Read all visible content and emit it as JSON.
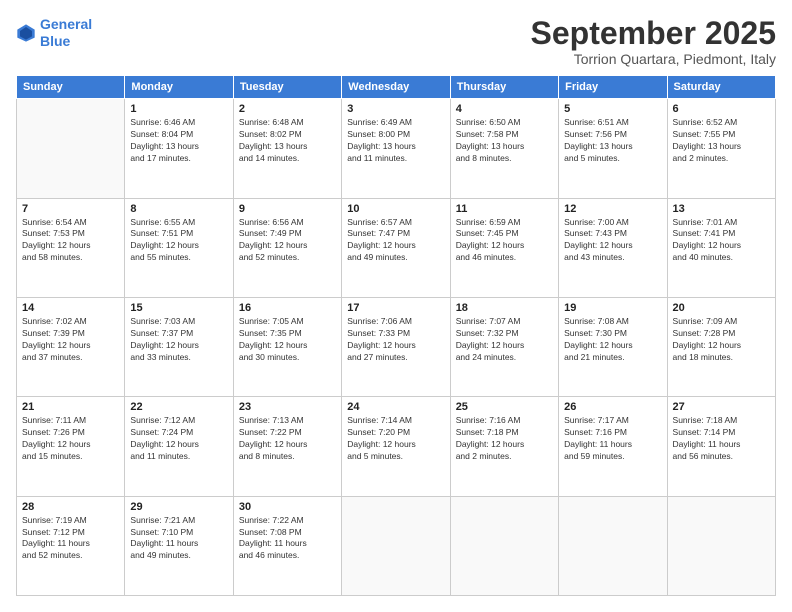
{
  "header": {
    "logo_line1": "General",
    "logo_line2": "Blue",
    "month_title": "September 2025",
    "location": "Torrion Quartara, Piedmont, Italy"
  },
  "weekdays": [
    "Sunday",
    "Monday",
    "Tuesday",
    "Wednesday",
    "Thursday",
    "Friday",
    "Saturday"
  ],
  "weeks": [
    [
      {
        "day": "",
        "info": ""
      },
      {
        "day": "1",
        "info": "Sunrise: 6:46 AM\nSunset: 8:04 PM\nDaylight: 13 hours\nand 17 minutes."
      },
      {
        "day": "2",
        "info": "Sunrise: 6:48 AM\nSunset: 8:02 PM\nDaylight: 13 hours\nand 14 minutes."
      },
      {
        "day": "3",
        "info": "Sunrise: 6:49 AM\nSunset: 8:00 PM\nDaylight: 13 hours\nand 11 minutes."
      },
      {
        "day": "4",
        "info": "Sunrise: 6:50 AM\nSunset: 7:58 PM\nDaylight: 13 hours\nand 8 minutes."
      },
      {
        "day": "5",
        "info": "Sunrise: 6:51 AM\nSunset: 7:56 PM\nDaylight: 13 hours\nand 5 minutes."
      },
      {
        "day": "6",
        "info": "Sunrise: 6:52 AM\nSunset: 7:55 PM\nDaylight: 13 hours\nand 2 minutes."
      }
    ],
    [
      {
        "day": "7",
        "info": "Sunrise: 6:54 AM\nSunset: 7:53 PM\nDaylight: 12 hours\nand 58 minutes."
      },
      {
        "day": "8",
        "info": "Sunrise: 6:55 AM\nSunset: 7:51 PM\nDaylight: 12 hours\nand 55 minutes."
      },
      {
        "day": "9",
        "info": "Sunrise: 6:56 AM\nSunset: 7:49 PM\nDaylight: 12 hours\nand 52 minutes."
      },
      {
        "day": "10",
        "info": "Sunrise: 6:57 AM\nSunset: 7:47 PM\nDaylight: 12 hours\nand 49 minutes."
      },
      {
        "day": "11",
        "info": "Sunrise: 6:59 AM\nSunset: 7:45 PM\nDaylight: 12 hours\nand 46 minutes."
      },
      {
        "day": "12",
        "info": "Sunrise: 7:00 AM\nSunset: 7:43 PM\nDaylight: 12 hours\nand 43 minutes."
      },
      {
        "day": "13",
        "info": "Sunrise: 7:01 AM\nSunset: 7:41 PM\nDaylight: 12 hours\nand 40 minutes."
      }
    ],
    [
      {
        "day": "14",
        "info": "Sunrise: 7:02 AM\nSunset: 7:39 PM\nDaylight: 12 hours\nand 37 minutes."
      },
      {
        "day": "15",
        "info": "Sunrise: 7:03 AM\nSunset: 7:37 PM\nDaylight: 12 hours\nand 33 minutes."
      },
      {
        "day": "16",
        "info": "Sunrise: 7:05 AM\nSunset: 7:35 PM\nDaylight: 12 hours\nand 30 minutes."
      },
      {
        "day": "17",
        "info": "Sunrise: 7:06 AM\nSunset: 7:33 PM\nDaylight: 12 hours\nand 27 minutes."
      },
      {
        "day": "18",
        "info": "Sunrise: 7:07 AM\nSunset: 7:32 PM\nDaylight: 12 hours\nand 24 minutes."
      },
      {
        "day": "19",
        "info": "Sunrise: 7:08 AM\nSunset: 7:30 PM\nDaylight: 12 hours\nand 21 minutes."
      },
      {
        "day": "20",
        "info": "Sunrise: 7:09 AM\nSunset: 7:28 PM\nDaylight: 12 hours\nand 18 minutes."
      }
    ],
    [
      {
        "day": "21",
        "info": "Sunrise: 7:11 AM\nSunset: 7:26 PM\nDaylight: 12 hours\nand 15 minutes."
      },
      {
        "day": "22",
        "info": "Sunrise: 7:12 AM\nSunset: 7:24 PM\nDaylight: 12 hours\nand 11 minutes."
      },
      {
        "day": "23",
        "info": "Sunrise: 7:13 AM\nSunset: 7:22 PM\nDaylight: 12 hours\nand 8 minutes."
      },
      {
        "day": "24",
        "info": "Sunrise: 7:14 AM\nSunset: 7:20 PM\nDaylight: 12 hours\nand 5 minutes."
      },
      {
        "day": "25",
        "info": "Sunrise: 7:16 AM\nSunset: 7:18 PM\nDaylight: 12 hours\nand 2 minutes."
      },
      {
        "day": "26",
        "info": "Sunrise: 7:17 AM\nSunset: 7:16 PM\nDaylight: 11 hours\nand 59 minutes."
      },
      {
        "day": "27",
        "info": "Sunrise: 7:18 AM\nSunset: 7:14 PM\nDaylight: 11 hours\nand 56 minutes."
      }
    ],
    [
      {
        "day": "28",
        "info": "Sunrise: 7:19 AM\nSunset: 7:12 PM\nDaylight: 11 hours\nand 52 minutes."
      },
      {
        "day": "29",
        "info": "Sunrise: 7:21 AM\nSunset: 7:10 PM\nDaylight: 11 hours\nand 49 minutes."
      },
      {
        "day": "30",
        "info": "Sunrise: 7:22 AM\nSunset: 7:08 PM\nDaylight: 11 hours\nand 46 minutes."
      },
      {
        "day": "",
        "info": ""
      },
      {
        "day": "",
        "info": ""
      },
      {
        "day": "",
        "info": ""
      },
      {
        "day": "",
        "info": ""
      }
    ]
  ]
}
